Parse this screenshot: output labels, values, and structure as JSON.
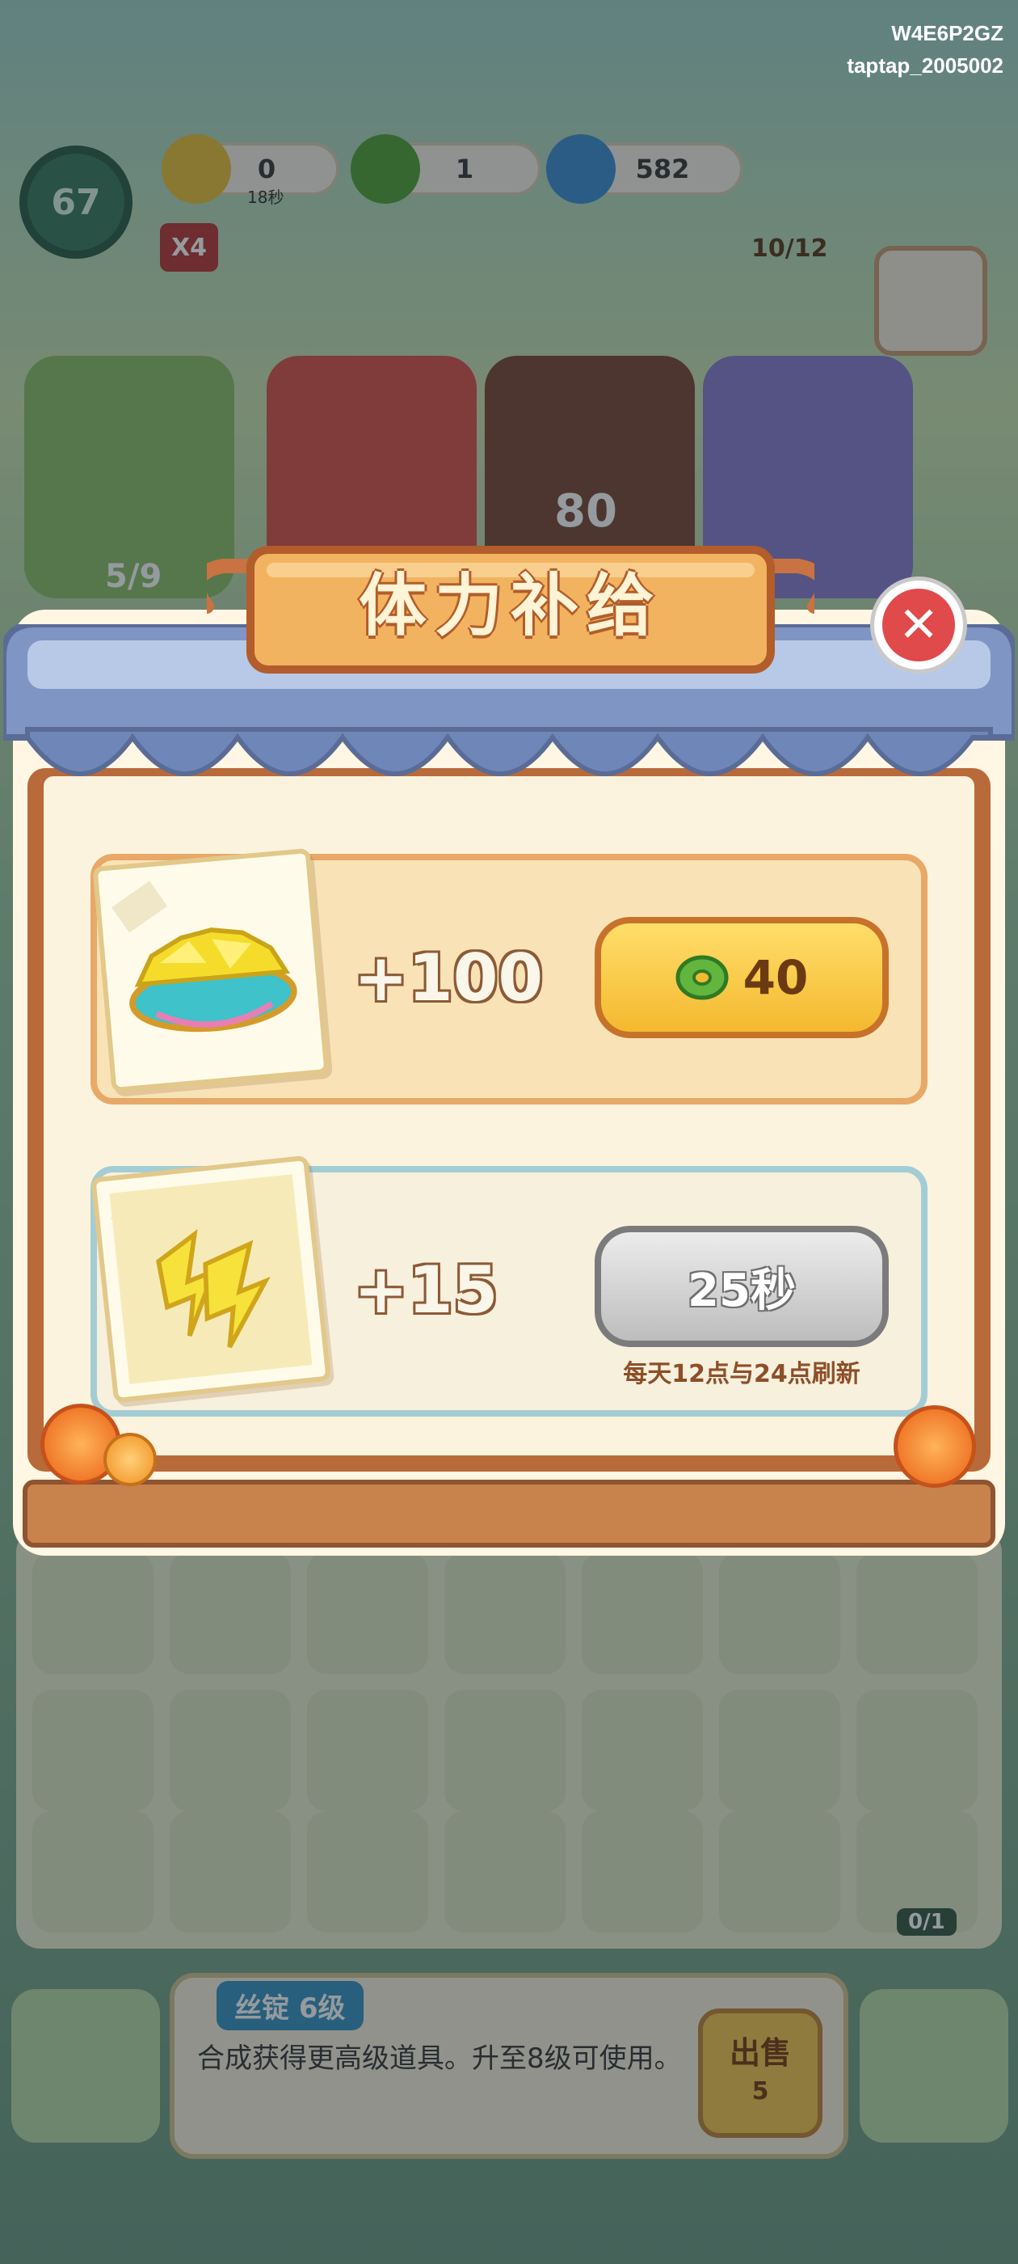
{
  "meta": {
    "account_id": "W4E6P2GZ",
    "channel": "taptap_2005002"
  },
  "hud": {
    "player_level": "67",
    "multiplier": "X4",
    "energy": {
      "value": "0",
      "sub": "18秒"
    },
    "coins": {
      "value": "1"
    },
    "gems": {
      "value": "582"
    }
  },
  "scene": {
    "card_progress": "5/9",
    "character_count": "10/12",
    "card_number": "80",
    "task_progress": "0/1"
  },
  "modal": {
    "title": "体力补给",
    "close_icon": "close-icon",
    "offers": [
      {
        "icon": "energy-basket-icon",
        "amount": "+100",
        "button": {
          "icon": "jade-coin-icon",
          "price": "40"
        }
      },
      {
        "icon": "energy-bolt-icon",
        "amount": "+15",
        "button": {
          "label": "25秒"
        },
        "note": "每天12点与24点刷新"
      }
    ]
  },
  "bottom_panel": {
    "item_name": "丝锭 6级",
    "item_description": "合成获得更高级道具。升至8级可使用。",
    "sell_label": "出售",
    "sell_price": "5"
  },
  "colors": {
    "accent_gold": "#f4b92f",
    "close_red": "#e04a4a",
    "wood": "#b86a3a",
    "awning_blue": "#7f95c4"
  }
}
